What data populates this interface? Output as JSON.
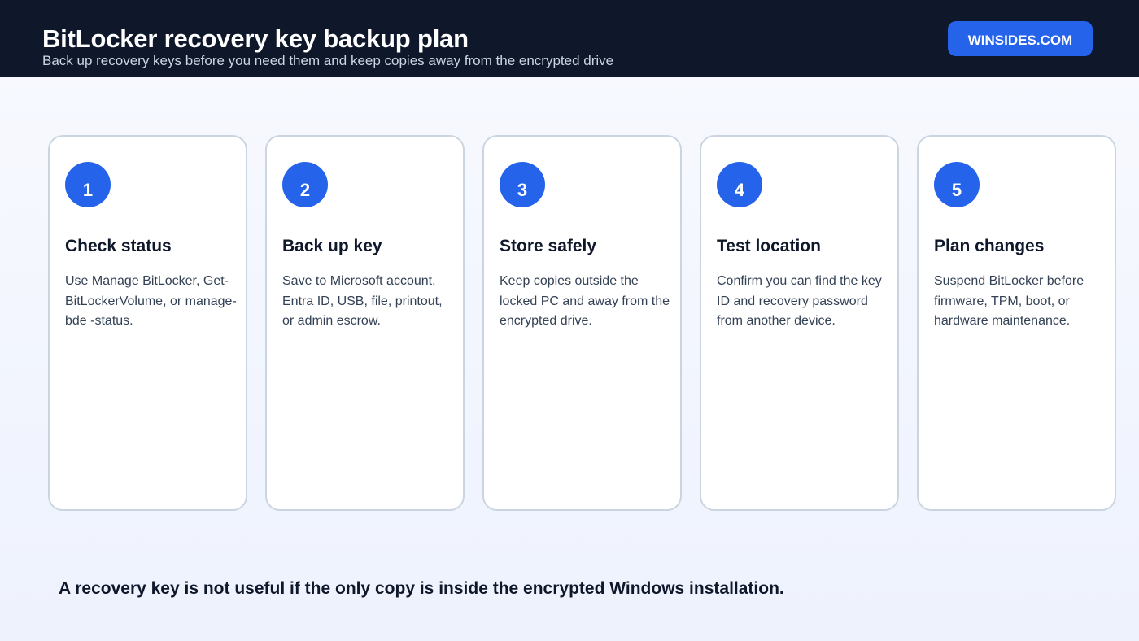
{
  "header": {
    "title": "BitLocker recovery key backup plan",
    "subtitle": "Back up recovery keys before you need them and keep copies away from the encrypted drive",
    "brand_label": "WINSIDES.COM"
  },
  "steps": [
    {
      "number": "1",
      "title": "Check status",
      "description": "Use Manage BitLocker, Get-BitLockerVolume, or manage-bde -status."
    },
    {
      "number": "2",
      "title": "Back up key",
      "description": "Save to Microsoft account, Entra ID, USB, file, printout, or admin escrow."
    },
    {
      "number": "3",
      "title": "Store safely",
      "description": "Keep copies outside the locked PC and away from the encrypted drive."
    },
    {
      "number": "4",
      "title": "Test location",
      "description": "Confirm you can find the key ID and recovery password from another device."
    },
    {
      "number": "5",
      "title": "Plan changes",
      "description": "Suspend BitLocker before firmware, TPM, boot, or hardware maintenance."
    }
  ],
  "footer": {
    "note": "A recovery key is not useful if the only copy is inside the encrypted Windows installation."
  },
  "colors": {
    "header_bg": "#0f172a",
    "accent": "#2563eb",
    "card_border": "#cbd5e1",
    "page_bg": "#f1f5fe"
  }
}
